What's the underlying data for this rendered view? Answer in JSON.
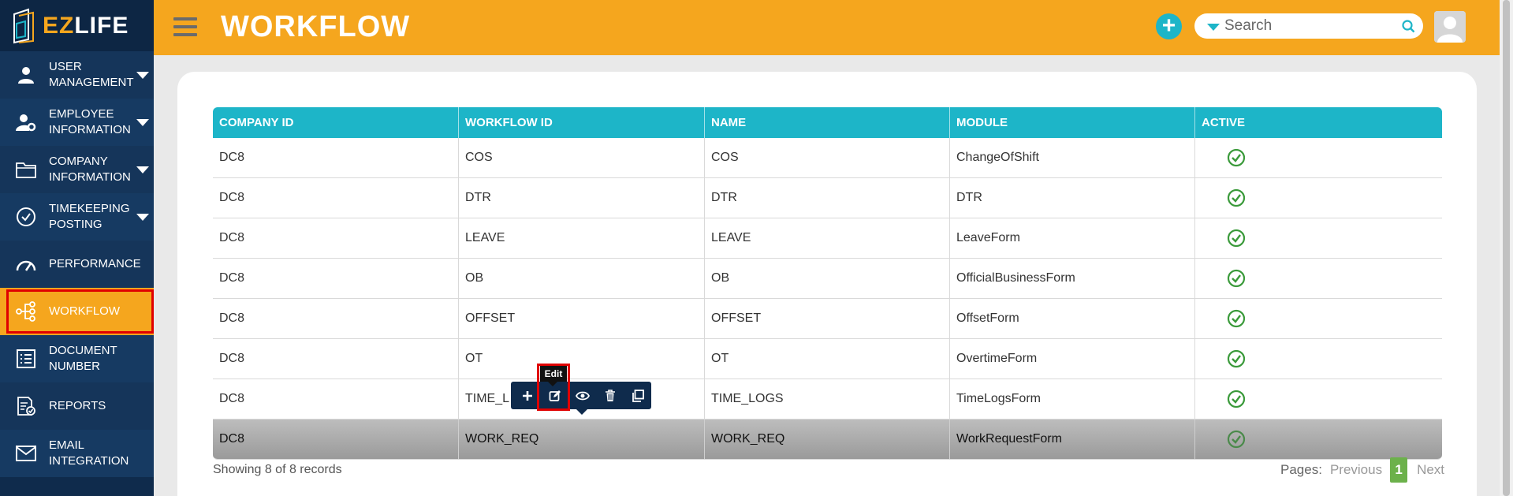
{
  "app": {
    "logo_prefix": "EZ",
    "logo_suffix": "LIFE"
  },
  "header": {
    "title": "WORKFLOW",
    "add_label": "+",
    "search_placeholder": "Search"
  },
  "sidebar": {
    "items": [
      {
        "label": "USER MANAGEMENT",
        "icon": "user-icon",
        "caret": true
      },
      {
        "label": "EMPLOYEE INFORMATION",
        "icon": "user-gear-icon",
        "caret": true
      },
      {
        "label": "COMPANY INFORMATION",
        "icon": "folder-icon",
        "caret": true
      },
      {
        "label": "TIMEKEEPING POSTING",
        "icon": "check-circle-icon",
        "caret": true
      },
      {
        "label": "PERFORMANCE",
        "icon": "gauge-icon",
        "caret": false
      },
      {
        "label": "WORKFLOW",
        "icon": "workflow-icon",
        "caret": false,
        "active": true
      },
      {
        "label": "DOCUMENT NUMBER",
        "icon": "document-list-icon",
        "caret": false
      },
      {
        "label": "REPORTS",
        "icon": "report-icon",
        "caret": false
      },
      {
        "label": "EMAIL INTEGRATION",
        "icon": "envelope-icon",
        "caret": false
      }
    ]
  },
  "table": {
    "columns": [
      "COMPANY ID",
      "WORKFLOW ID",
      "NAME",
      "MODULE",
      "ACTIVE"
    ],
    "rows": [
      [
        "DC8",
        "COS",
        "COS",
        "ChangeOfShift"
      ],
      [
        "DC8",
        "DTR",
        "DTR",
        "DTR"
      ],
      [
        "DC8",
        "LEAVE",
        "LEAVE",
        "LeaveForm"
      ],
      [
        "DC8",
        "OB",
        "OB",
        "OfficialBusinessForm"
      ],
      [
        "DC8",
        "OFFSET",
        "OFFSET",
        "OffsetForm"
      ],
      [
        "DC8",
        "OT",
        "OT",
        "OvertimeForm"
      ],
      [
        "DC8",
        "TIME_L",
        "TIME_LOGS",
        "TimeLogsForm"
      ],
      [
        "DC8",
        "WORK_REQ",
        "WORK_REQ",
        "WorkRequestForm"
      ]
    ],
    "active_color": "#3a9a3a",
    "selected_row": 7
  },
  "toolbar": {
    "tooltip": "Edit",
    "tools": [
      "plus-icon",
      "edit-icon",
      "eye-icon",
      "trash-icon",
      "copy-icon"
    ]
  },
  "footer": {
    "records_text": "Showing 8 of 8 records",
    "pages_label": "Pages:",
    "previous": "Previous",
    "current_page": "1",
    "next": "Next"
  },
  "colors": {
    "header": "#f5a61e",
    "sidebar": "#0f2b4c",
    "table_header": "#1db5c8",
    "page_active": "#6cb14b"
  }
}
